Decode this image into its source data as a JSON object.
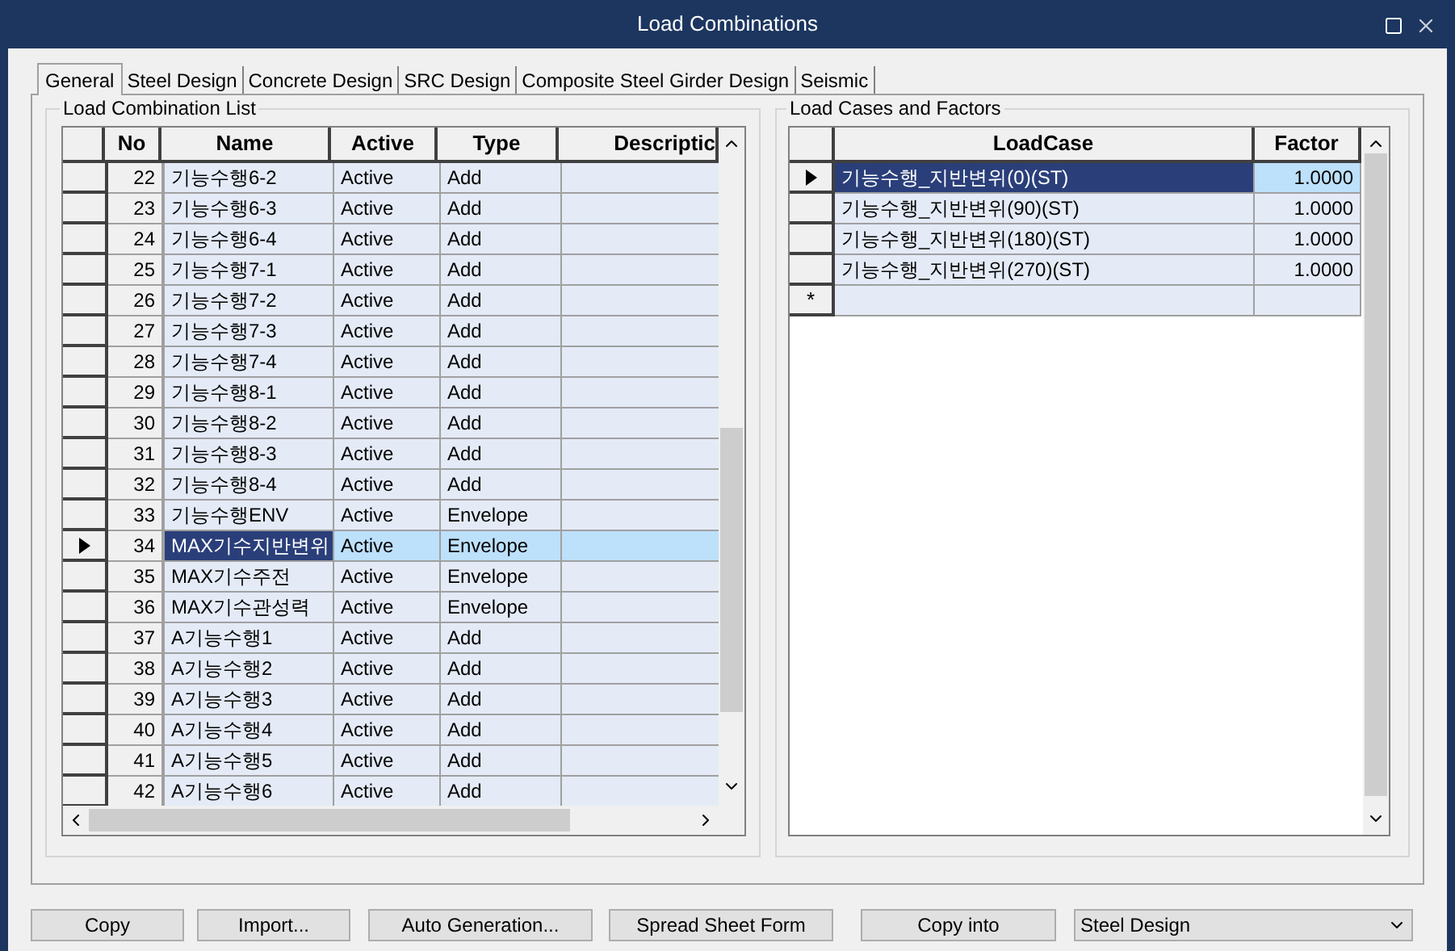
{
  "window": {
    "title": "Load Combinations"
  },
  "tabs": [
    {
      "label": "General",
      "selected": true
    },
    {
      "label": "Steel Design",
      "selected": false
    },
    {
      "label": "Concrete Design",
      "selected": false
    },
    {
      "label": "SRC Design",
      "selected": false
    },
    {
      "label": "Composite Steel Girder Design",
      "selected": false
    },
    {
      "label": "Seismic",
      "selected": false
    }
  ],
  "combination_list": {
    "title": "Load Combination List",
    "columns": [
      "No",
      "Name",
      "Active",
      "Type",
      "Descriptic"
    ],
    "rows": [
      {
        "no": "22",
        "name": "기능수행6-2",
        "active": "Active",
        "type": "Add",
        "selected": false
      },
      {
        "no": "23",
        "name": "기능수행6-3",
        "active": "Active",
        "type": "Add",
        "selected": false
      },
      {
        "no": "24",
        "name": "기능수행6-4",
        "active": "Active",
        "type": "Add",
        "selected": false
      },
      {
        "no": "25",
        "name": "기능수행7-1",
        "active": "Active",
        "type": "Add",
        "selected": false
      },
      {
        "no": "26",
        "name": "기능수행7-2",
        "active": "Active",
        "type": "Add",
        "selected": false
      },
      {
        "no": "27",
        "name": "기능수행7-3",
        "active": "Active",
        "type": "Add",
        "selected": false
      },
      {
        "no": "28",
        "name": "기능수행7-4",
        "active": "Active",
        "type": "Add",
        "selected": false
      },
      {
        "no": "29",
        "name": "기능수행8-1",
        "active": "Active",
        "type": "Add",
        "selected": false
      },
      {
        "no": "30",
        "name": "기능수행8-2",
        "active": "Active",
        "type": "Add",
        "selected": false
      },
      {
        "no": "31",
        "name": "기능수행8-3",
        "active": "Active",
        "type": "Add",
        "selected": false
      },
      {
        "no": "32",
        "name": "기능수행8-4",
        "active": "Active",
        "type": "Add",
        "selected": false
      },
      {
        "no": "33",
        "name": "기능수행ENV",
        "active": "Active",
        "type": "Envelope",
        "selected": false
      },
      {
        "no": "34",
        "name": "MAX기수지반변위",
        "active": "Active",
        "type": "Envelope",
        "selected": true
      },
      {
        "no": "35",
        "name": "MAX기수주전",
        "active": "Active",
        "type": "Envelope",
        "selected": false
      },
      {
        "no": "36",
        "name": "MAX기수관성력",
        "active": "Active",
        "type": "Envelope",
        "selected": false
      },
      {
        "no": "37",
        "name": "A기능수행1",
        "active": "Active",
        "type": "Add",
        "selected": false
      },
      {
        "no": "38",
        "name": "A기능수행2",
        "active": "Active",
        "type": "Add",
        "selected": false
      },
      {
        "no": "39",
        "name": "A기능수행3",
        "active": "Active",
        "type": "Add",
        "selected": false
      },
      {
        "no": "40",
        "name": "A기능수행4",
        "active": "Active",
        "type": "Add",
        "selected": false
      },
      {
        "no": "41",
        "name": "A기능수행5",
        "active": "Active",
        "type": "Add",
        "selected": false
      },
      {
        "no": "42",
        "name": "A기능수행6",
        "active": "Active",
        "type": "Add",
        "selected": false
      }
    ]
  },
  "load_cases": {
    "title": "Load Cases and Factors",
    "columns": [
      "LoadCase",
      "Factor"
    ],
    "rows": [
      {
        "load_case": "기능수행_지반변위(0)(ST)",
        "factor": "1.0000",
        "selected": true
      },
      {
        "load_case": "기능수행_지반변위(90)(ST)",
        "factor": "1.0000",
        "selected": false
      },
      {
        "load_case": "기능수행_지반변위(180)(ST)",
        "factor": "1.0000",
        "selected": false
      },
      {
        "load_case": "기능수행_지반변위(270)(ST)",
        "factor": "1.0000",
        "selected": false
      }
    ],
    "new_row_marker": "*"
  },
  "buttons": [
    "Copy",
    "Import...",
    "Auto Generation...",
    "Spread Sheet Form",
    "Copy into"
  ],
  "copy_target": {
    "value": "Steel Design"
  }
}
